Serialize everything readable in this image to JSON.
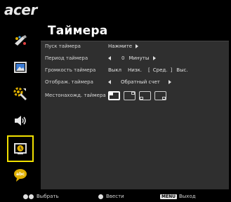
{
  "header": {
    "logo": "acer",
    "title": "Таймера"
  },
  "sidebar": {
    "items": [
      {
        "name": "color-icon"
      },
      {
        "name": "image-icon"
      },
      {
        "name": "settings-icon"
      },
      {
        "name": "audio-icon"
      },
      {
        "name": "timer-icon",
        "selected": true
      },
      {
        "name": "language-icon"
      }
    ]
  },
  "settings": {
    "start_timer": {
      "label": "Пуск таймера",
      "value": "Нажмите"
    },
    "timer_period": {
      "label": "Период таймера",
      "value": "0",
      "unit": "Минуты"
    },
    "timer_volume": {
      "label": "Громкость таймера",
      "options": [
        "Выкл",
        "Низк.",
        "Сред.",
        "Выс."
      ],
      "selected": "Сред."
    },
    "timer_display": {
      "label": "Отображ. таймера",
      "value": "Обратный счет"
    },
    "timer_location": {
      "label": "Местонахожд. таймера",
      "options": 4,
      "selected_index": 0
    }
  },
  "footer": {
    "select": "Выбрать",
    "enter": "Ввести",
    "menu_key": "MENU",
    "exit": "Выход"
  },
  "colors": {
    "panel_bg": "#2f2f2f",
    "selection_outline": "#f1e000",
    "background": "#000000"
  }
}
